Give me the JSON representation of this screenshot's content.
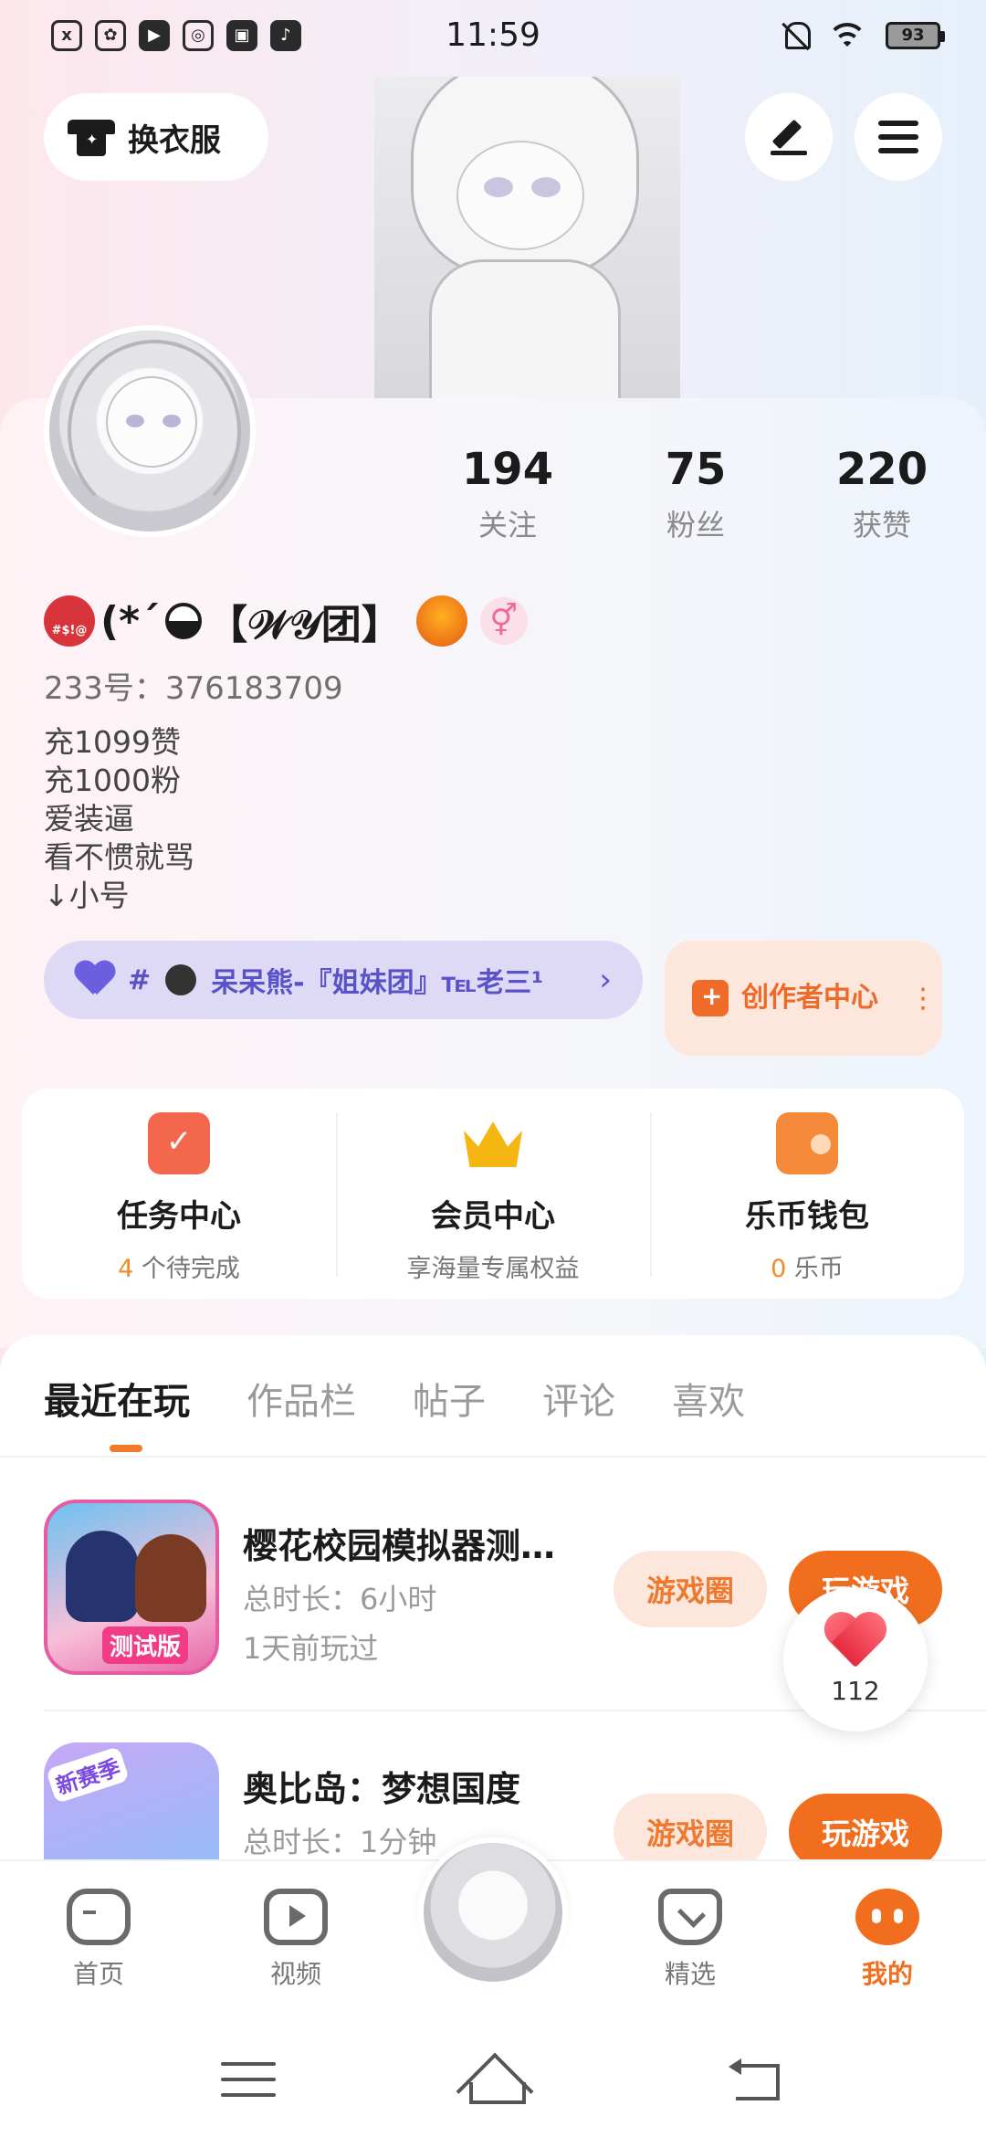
{
  "status_bar": {
    "time": "11:59",
    "battery": "93",
    "app_icons": [
      "x",
      "✿",
      "▶",
      "◎",
      "▣",
      "♪"
    ]
  },
  "header": {
    "outfit_label": "换衣服",
    "edit_icon": "pen-icon",
    "menu_icon": "menu-icon"
  },
  "profile": {
    "stats": [
      {
        "value": "194",
        "label": "关注"
      },
      {
        "value": "75",
        "label": "粉丝"
      },
      {
        "value": "220",
        "label": "获赞"
      }
    ],
    "nickname_parts": {
      "emoji_text": "#$!@",
      "prefix": "(*´",
      "group": "【𝒲𝒴团】",
      "gender_symbol": "⚥"
    },
    "id_line": "233号：376183709",
    "bio_lines": [
      "充1099赞",
      "充1000粉",
      "爱装逼",
      "看不惯就骂",
      "↓小号"
    ],
    "group_chip": {
      "prefix": "#",
      "text": "呆呆熊-『姐妹团』℡老三¹",
      "chevron": "›"
    },
    "creator_center": {
      "label": "创作者中心",
      "dots": "⋮"
    }
  },
  "services": [
    {
      "title": "任务中心",
      "highlight": "4",
      "sub": " 个待完成",
      "icon": "calendar-check-icon"
    },
    {
      "title": "会员中心",
      "highlight": "",
      "sub": "享海量专属权益",
      "icon": "crown-icon"
    },
    {
      "title": "乐币钱包",
      "highlight": "0",
      "sub": " 乐币",
      "icon": "wallet-icon"
    }
  ],
  "tabs": [
    "最近在玩",
    "作品栏",
    "帖子",
    "评论",
    "喜欢"
  ],
  "games": [
    {
      "title": "樱花校园模拟器测…",
      "duration": "总时长：6小时",
      "last_played": "1天前玩过",
      "icon_badge": "测试版",
      "circle_label": "游戏圈",
      "play_label": "玩游戏"
    },
    {
      "title": "奥比岛：梦想国度",
      "duration": "总时长：1分钟",
      "icon_badge": "新赛季",
      "circle_label": "游戏圈",
      "play_label": "玩游戏"
    }
  ],
  "like_float": {
    "count": "112"
  },
  "bottom_nav": [
    {
      "label": "首页",
      "icon": "gamepad-icon",
      "active": false
    },
    {
      "label": "视频",
      "icon": "video-icon",
      "active": false
    },
    {
      "label": "精选",
      "icon": "heart-box-icon",
      "active": false
    },
    {
      "label": "我的",
      "icon": "me-icon",
      "active": true
    }
  ],
  "colors": {
    "accent": "#f26e1f",
    "group_chip_bg": "#dedaf6",
    "group_chip_text": "#5a52c8"
  }
}
